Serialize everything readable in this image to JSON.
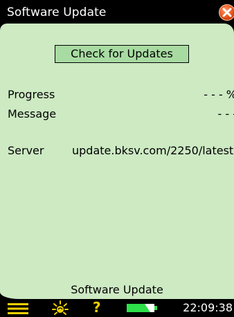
{
  "window": {
    "title": "Software Update"
  },
  "actions": {
    "check_updates_label": "Check for Updates"
  },
  "fields": {
    "progress": {
      "label": "Progress",
      "value": "- - - %"
    },
    "message": {
      "label": "Message",
      "value": "- - -"
    },
    "server": {
      "label": "Server",
      "value": "update.bksv.com/2250/latest"
    }
  },
  "footer": {
    "title": "Software Update"
  },
  "status_bar": {
    "time": "22:09:38",
    "icons": [
      "menu-icon",
      "backlight-icon",
      "help-icon",
      "battery-icon"
    ]
  },
  "colors": {
    "panel_bg": "#cdeac3",
    "button_bg": "#a8dba2",
    "close_btn": "#e04a10",
    "help_icon": "#f2d000",
    "battery_fill": "#2ee04a",
    "backlight_icon": "#f2d000"
  }
}
